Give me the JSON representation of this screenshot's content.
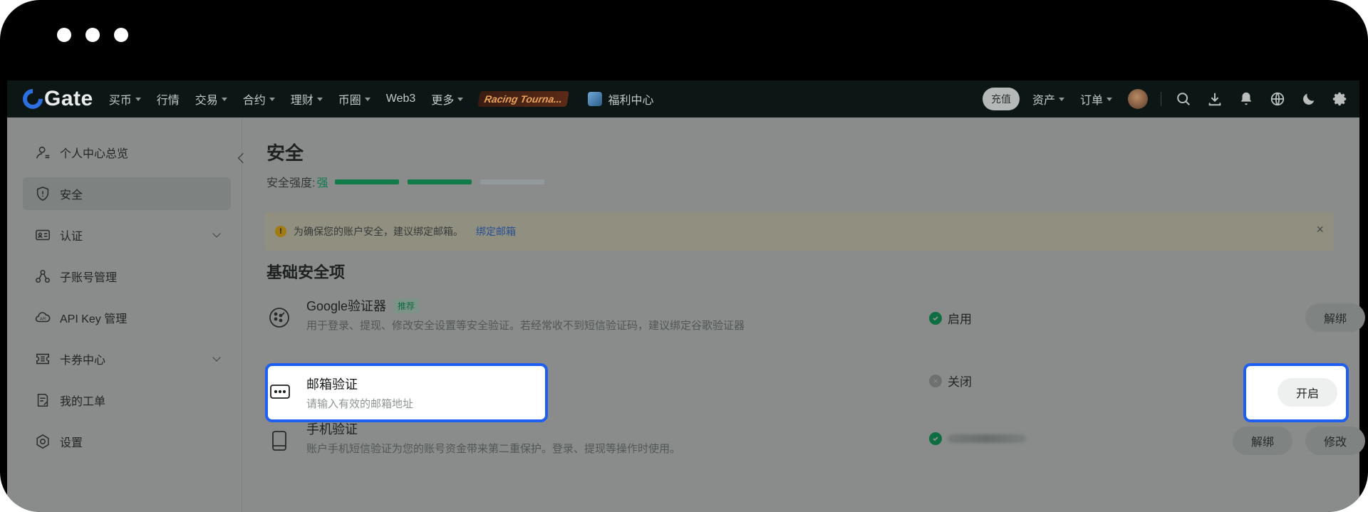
{
  "nav": {
    "logo": "Gate",
    "items": [
      {
        "label": "买币",
        "caret": true
      },
      {
        "label": "行情",
        "caret": false
      },
      {
        "label": "交易",
        "caret": true
      },
      {
        "label": "合约",
        "caret": true
      },
      {
        "label": "理财",
        "caret": true
      },
      {
        "label": "币圈",
        "caret": true
      },
      {
        "label": "Web3",
        "caret": false
      },
      {
        "label": "更多",
        "caret": true
      }
    ],
    "promo": "Racing Tourna...",
    "welfare": "福利中心",
    "deposit": "充值",
    "assets": "资产",
    "orders": "订单",
    "icons": [
      "search-icon",
      "download-icon",
      "bell-icon",
      "globe-icon",
      "moon-icon",
      "gear-icon"
    ]
  },
  "sidebar": {
    "items": [
      {
        "label": "个人中心总览",
        "icon": "user-icon"
      },
      {
        "label": "安全",
        "icon": "shield-icon",
        "active": true
      },
      {
        "label": "认证",
        "icon": "id-card-icon",
        "expandable": true
      },
      {
        "label": "子账号管理",
        "icon": "sub-account-icon"
      },
      {
        "label": "API Key 管理",
        "icon": "api-icon"
      },
      {
        "label": "卡券中心",
        "icon": "coupon-icon",
        "expandable": true
      },
      {
        "label": "我的工单",
        "icon": "ticket-icon"
      },
      {
        "label": "设置",
        "icon": "settings-icon"
      }
    ]
  },
  "main": {
    "title": "安全",
    "strength_label": "安全强度:",
    "strength_value": "强",
    "strength_level": 2,
    "strength_max": 3,
    "banner": {
      "text": "为确保您的账户安全，建议绑定邮箱。",
      "link": "绑定邮箱",
      "close": "×"
    },
    "section_title": "基础安全项",
    "items": [
      {
        "title": "Google验证器",
        "tag": "推荐",
        "desc": "用于登录、提现、修改安全设置等安全验证。若经常收不到短信验证码，建议绑定谷歌验证器",
        "status": "启用",
        "buttons": [
          "解绑"
        ]
      },
      {
        "title": "邮箱验证",
        "desc": "请输入有效的邮箱地址",
        "status": "关闭",
        "buttons": [
          "开启"
        ]
      },
      {
        "title": "手机验证",
        "desc": "账户手机短信验证为您的账号资金带来第二重保护。登录、提现等操作时使用。",
        "status": "",
        "buttons": [
          "解绑",
          "修改"
        ]
      }
    ]
  }
}
